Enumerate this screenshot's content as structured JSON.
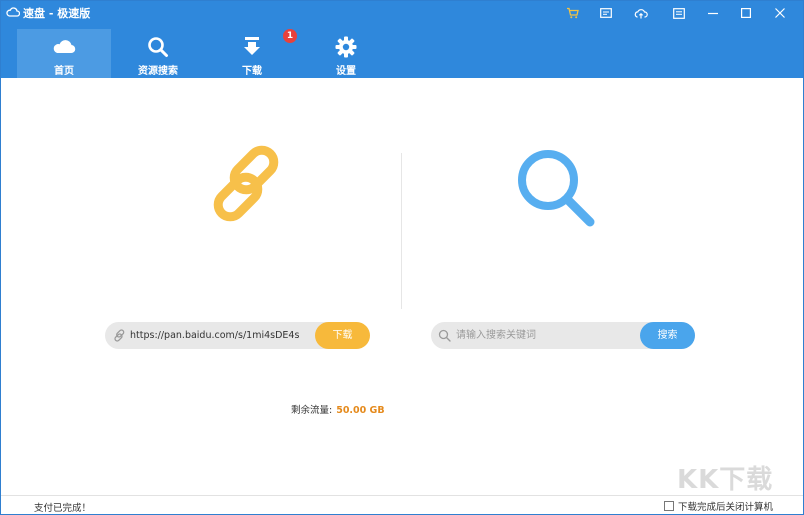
{
  "window": {
    "title": "速盘 - 极速版",
    "controls": [
      "cart-icon",
      "message-icon",
      "cloud-sync-icon",
      "menu-icon",
      "minimize-icon",
      "maximize-icon",
      "close-icon"
    ]
  },
  "nav": {
    "items": [
      {
        "label": "首页",
        "icon": "cloud-icon",
        "active": true
      },
      {
        "label": "资源搜索",
        "icon": "search-icon",
        "active": false
      },
      {
        "label": "下载",
        "icon": "download-icon",
        "active": false
      },
      {
        "label": "设置",
        "icon": "gear-icon",
        "active": false
      }
    ],
    "download_badge": "1"
  },
  "link_panel": {
    "url_value": "https://pan.baidu.com/s/1mi4sDE4s",
    "download_label": "下载"
  },
  "search_panel": {
    "placeholder": "请输入搜索关键词",
    "search_label": "搜索"
  },
  "traffic": {
    "label": "剩余流量:",
    "value": "50.00 GB"
  },
  "status": {
    "message": "支付已完成！",
    "shutdown_label": "下载完成后关闭计算机",
    "shutdown_checked": false
  },
  "watermark": "KK下载",
  "colors": {
    "header": "#2f88dc",
    "active_tab": "#4c9be3",
    "download_button": "#f7b93b",
    "search_button": "#4aa5ec",
    "traffic_value": "#e58a1c",
    "badge": "#e8413b"
  }
}
